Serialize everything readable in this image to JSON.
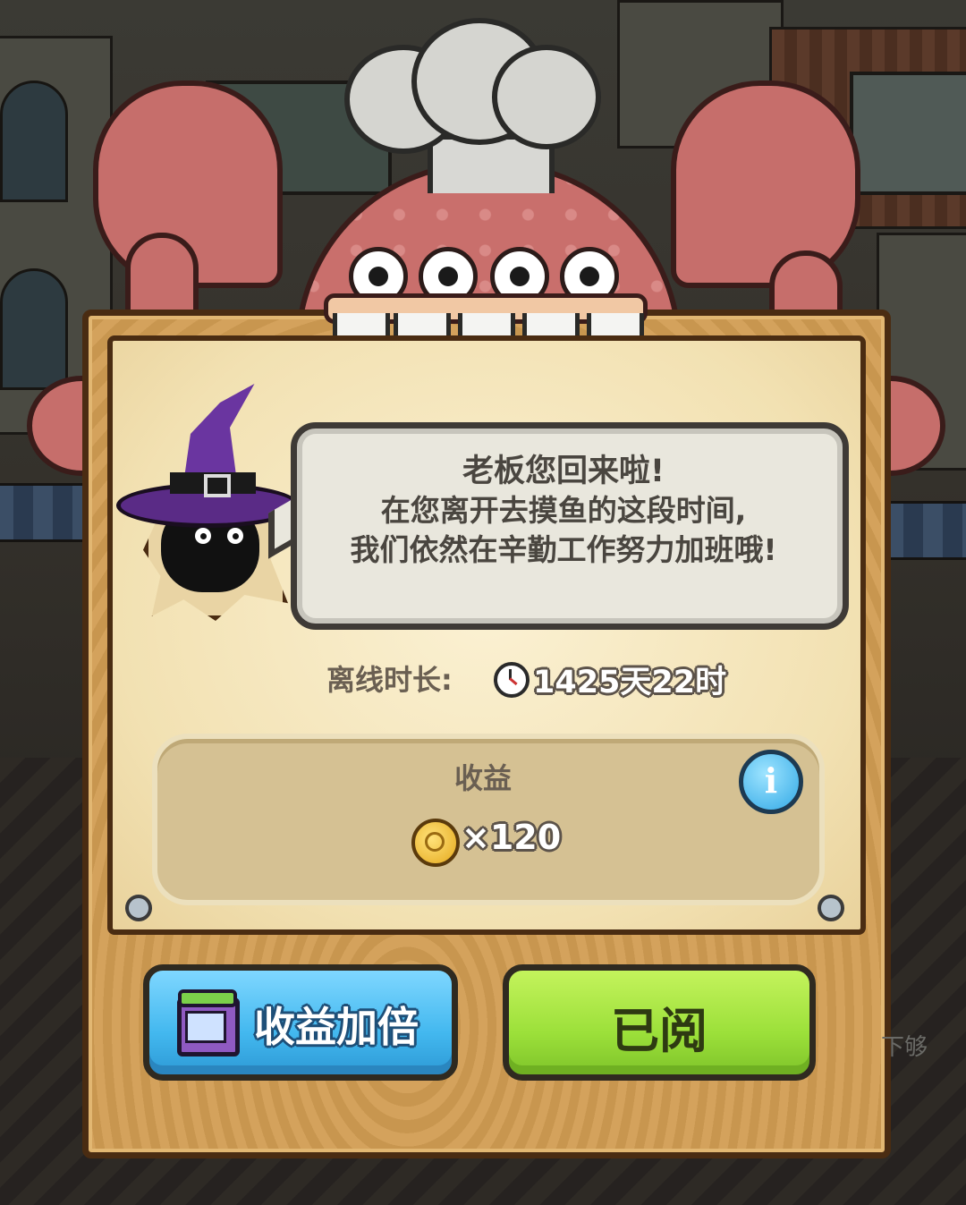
{
  "dialog": {
    "speech": {
      "line1": "老板您回来啦!",
      "line2": "在您离开去摸鱼的这段时间,",
      "line3": "我们依然在辛勤工作努力加班哦!"
    },
    "offline": {
      "label": "离线时长:",
      "value": "1425天22时",
      "icon": "clock-icon"
    },
    "reward": {
      "title": "收益",
      "info_icon": "i",
      "coin_icon": "coin-icon",
      "quantity": "×120"
    },
    "buttons": {
      "double_label": "收益加倍",
      "double_icon": "tv-icon",
      "read_label": "已阅"
    }
  },
  "background": {
    "edge_hint": "下够"
  },
  "colors": {
    "double_button": "#43b8ef",
    "read_button": "#9ce03a",
    "board": "#cf9f58",
    "octopus": "#c96f6c",
    "witch_hat": "#6a35a0"
  }
}
